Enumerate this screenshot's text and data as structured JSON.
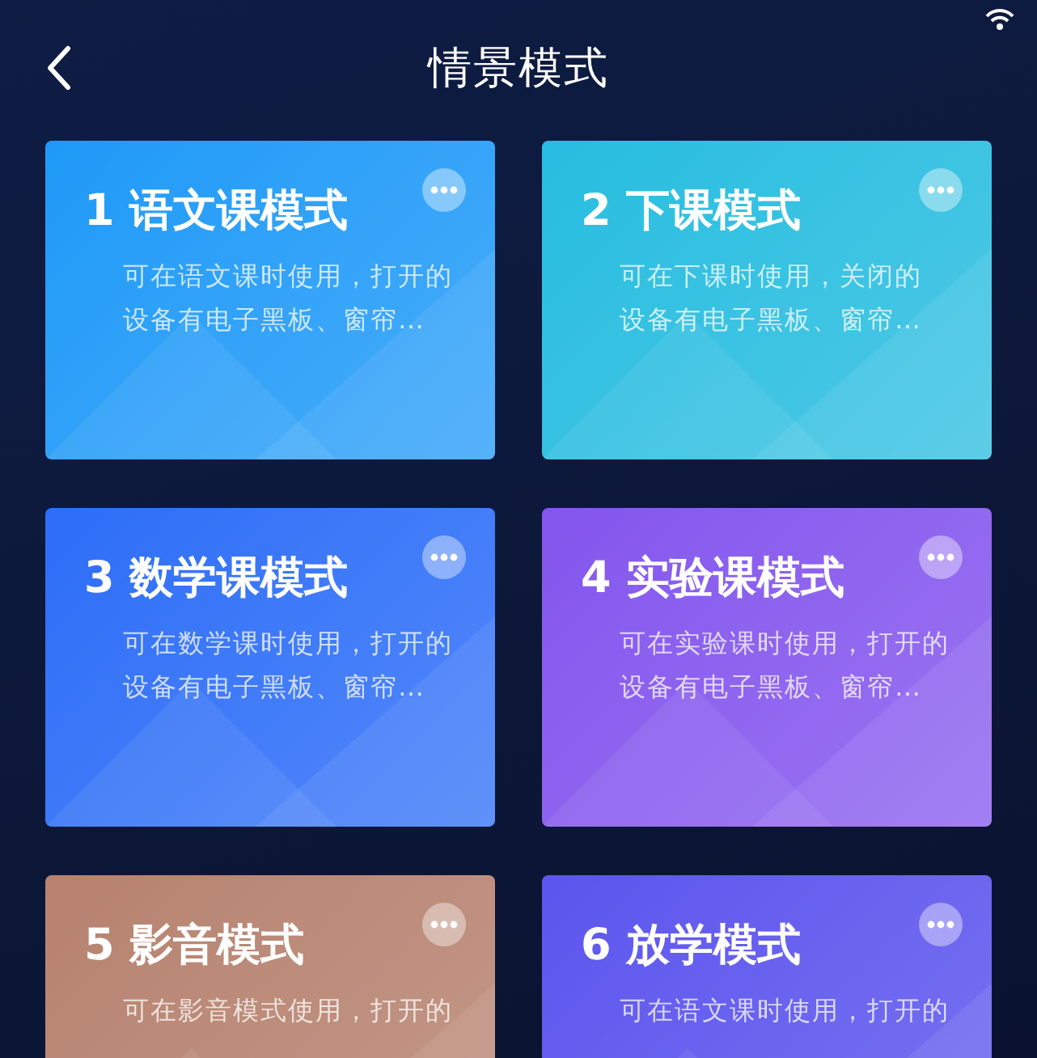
{
  "header": {
    "title": "情景模式"
  },
  "modes": [
    {
      "title": "1 语文课模式",
      "description": [
        "可在语文课时使用，打开的",
        "设备有电子黑板、窗帘…"
      ],
      "color": "#1f9af8"
    },
    {
      "title": "2 下课模式",
      "description": [
        "可在下课时使用，关闭的",
        "设备有电子黑板、窗帘…"
      ],
      "color": "#27bde0"
    },
    {
      "title": "3 数学课模式",
      "description": [
        "可在数学课时使用，打开的",
        "设备有电子黑板、窗帘…"
      ],
      "color": "#2d6ef8"
    },
    {
      "title": "4 实验课模式",
      "description": [
        "可在实验课时使用，打开的",
        "设备有电子黑板、窗帘…"
      ],
      "color": "#8456ee"
    },
    {
      "title": "5 影音模式",
      "description": [
        "可在影音模式使用，打开的"
      ],
      "color": "#b7826f"
    },
    {
      "title": "6 放学模式",
      "description": [
        "可在语文课时使用，打开的"
      ],
      "color": "#5c55ee"
    }
  ]
}
